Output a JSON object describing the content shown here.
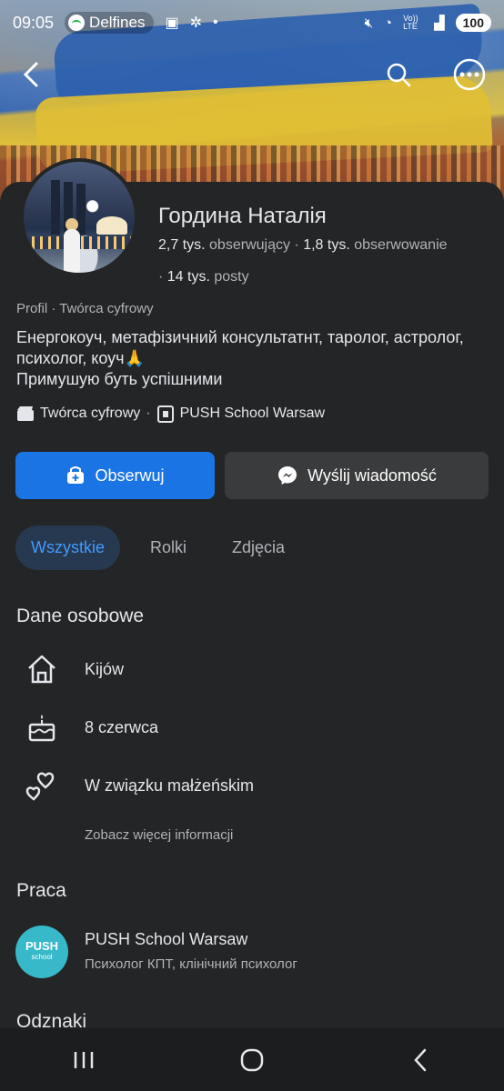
{
  "status_bar": {
    "time": "09:05",
    "spotify_label": "Delfines",
    "signal_label": "Vo)) LTE",
    "battery": "100"
  },
  "profile": {
    "name": "Гордина Наталія",
    "followers_count": "2,7 tys.",
    "followers_label": "obserwujący",
    "following_count": "1,8 tys.",
    "following_label": "obserwowanie",
    "posts_count": "14 tys.",
    "posts_label": "posty",
    "category": "Profil · Twórca cyfrowy",
    "bio_line1": "Енергокоуч, метафізичний консультатнт, таролог, астролог,",
    "bio_line2": "психолог, коуч🙏",
    "bio_line3": "Примушую буть успішними",
    "tag1": "Twórca cyfrowy",
    "tag_sep": "·",
    "tag2": "PUSH School Warsaw"
  },
  "actions": {
    "follow_label": "Obserwuj",
    "message_label": "Wyślij wiadomość"
  },
  "tabs": [
    {
      "label": "Wszystkie",
      "active": true
    },
    {
      "label": "Rolki",
      "active": false
    },
    {
      "label": "Zdjęcia",
      "active": false
    }
  ],
  "personal": {
    "title": "Dane osobowe",
    "items": [
      {
        "icon": "home-icon",
        "text": "Kijów"
      },
      {
        "icon": "birthday-cake-icon",
        "text": "8 czerwca"
      },
      {
        "icon": "relationship-hearts-icon",
        "text": "W związku małżeńskim"
      }
    ],
    "more": "Zobacz więcej informacji"
  },
  "work": {
    "title": "Praca",
    "logo_text": "PUSH",
    "logo_sub": "school",
    "company": "PUSH School Warsaw",
    "role": "Психолог КПТ, клінічний психолог"
  },
  "badges": {
    "title": "Odznaki"
  },
  "colors": {
    "accent": "#1b74e4",
    "background": "#242526",
    "secondary_button": "#3a3b3c",
    "active_tab_bg": "#263951",
    "active_tab_text": "#4599ff"
  }
}
